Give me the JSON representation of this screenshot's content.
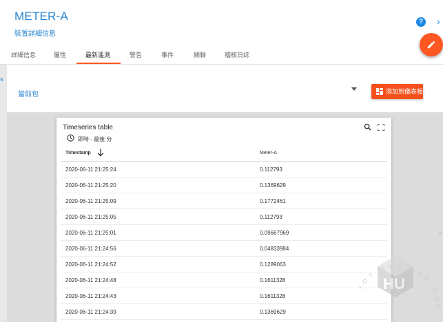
{
  "header": {
    "title": "METER-A",
    "subtitle": "裝置詳細信息",
    "help_glyph": "?",
    "close_glyph": "›"
  },
  "tabs": [
    {
      "label": "詳細信息",
      "active": false
    },
    {
      "label": "屬性",
      "active": false
    },
    {
      "label": "最新遙測",
      "active": true
    },
    {
      "label": "警告",
      "active": false
    },
    {
      "label": "事件",
      "active": false
    },
    {
      "label": "關聯",
      "active": false
    },
    {
      "label": "稽核日誌",
      "active": false
    }
  ],
  "left_edge_mark": "s",
  "toolbar": {
    "state_label": "當前包",
    "add_to_dashboard_label": "添加到儀表板"
  },
  "widget": {
    "title": "Timeseries table",
    "time_window": "即時 - 最後 分",
    "columns": {
      "timestamp": "Timestamp",
      "value": "Meter-A"
    },
    "rows": [
      {
        "timestamp": "2020-06-11 21:25:24",
        "value": "0.112793"
      },
      {
        "timestamp": "2020-06-11 21:25:20",
        "value": "0.1369629"
      },
      {
        "timestamp": "2020-06-11 21:25:09",
        "value": "0.1772461"
      },
      {
        "timestamp": "2020-06-11 21:25:05",
        "value": "0.112793"
      },
      {
        "timestamp": "2020-06-11 21:25:01",
        "value": "0.09667969"
      },
      {
        "timestamp": "2020-06-11 21:24:56",
        "value": "0.04833984"
      },
      {
        "timestamp": "2020-06-11 21:24:52",
        "value": "0.1289063"
      },
      {
        "timestamp": "2020-06-11 21:24:48",
        "value": "0.1611328"
      },
      {
        "timestamp": "2020-06-11 21:24:43",
        "value": "0.1611328"
      },
      {
        "timestamp": "2020-06-11 21:24:39",
        "value": "0.1369629"
      }
    ]
  },
  "watermark": {
    "text": "IOT SERVICE HUB",
    "logo_text": "HU"
  },
  "colors": {
    "accent": "#2a86d0",
    "fab": "#ff5722",
    "button": "#f4511e",
    "help": "#1e88e5"
  },
  "icons": {
    "help": "help-circle-icon",
    "close": "chevron-right-icon",
    "edit": "pencil-icon",
    "dropdown": "caret-down-icon",
    "dashboard": "dashboard-icon",
    "time": "clock-icon",
    "search": "search-icon",
    "fullscreen": "fullscreen-icon",
    "sort": "arrow-down-icon"
  }
}
